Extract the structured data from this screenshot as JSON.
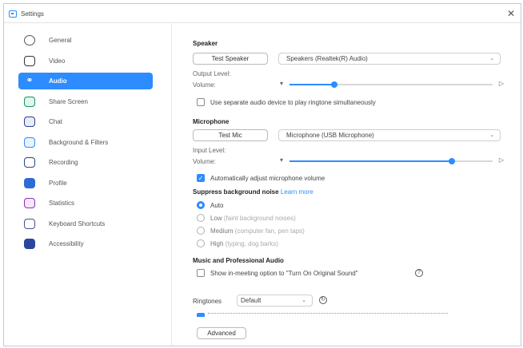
{
  "window": {
    "title": "Settings",
    "close_glyph": "✕"
  },
  "sidebar": {
    "items": [
      {
        "label": "General",
        "icon": "gear-icon"
      },
      {
        "label": "Video",
        "icon": "video-icon"
      },
      {
        "label": "Audio",
        "icon": "headphones-icon",
        "active": true
      },
      {
        "label": "Share Screen",
        "icon": "share-screen-icon"
      },
      {
        "label": "Chat",
        "icon": "chat-icon"
      },
      {
        "label": "Background & Filters",
        "icon": "background-icon"
      },
      {
        "label": "Recording",
        "icon": "recording-icon"
      },
      {
        "label": "Profile",
        "icon": "profile-icon"
      },
      {
        "label": "Statistics",
        "icon": "statistics-icon"
      },
      {
        "label": "Keyboard Shortcuts",
        "icon": "keyboard-icon"
      },
      {
        "label": "Accessibility",
        "icon": "accessibility-icon"
      }
    ]
  },
  "speaker": {
    "title": "Speaker",
    "test_button": "Test Speaker",
    "device": "Speakers (Realtek(R) Audio)",
    "output_level_label": "Output Level:",
    "volume_label": "Volume:",
    "volume_level": 0.22,
    "separate_device_label": "Use separate audio device to play ringtone simultaneously",
    "separate_device_checked": false
  },
  "microphone": {
    "title": "Microphone",
    "test_button": "Test Mic",
    "device": "Microphone (USB Microphone)",
    "input_level_label": "Input Level:",
    "volume_label": "Volume:",
    "volume_level": 0.8,
    "auto_adjust_label": "Automatically adjust microphone volume",
    "auto_adjust_checked": true
  },
  "suppress": {
    "title": "Suppress background noise",
    "learn_more": "Learn more",
    "options": [
      {
        "name": "Auto",
        "desc": "",
        "selected": true
      },
      {
        "name": "Low",
        "desc": "(faint background noises)",
        "selected": false
      },
      {
        "name": "Medium",
        "desc": "(computer fan, pen taps)",
        "selected": false
      },
      {
        "name": "High",
        "desc": "(typing, dog barks)",
        "selected": false
      }
    ]
  },
  "music": {
    "title": "Music and Professional Audio",
    "show_option_label": "Show in-meeting option to \"Turn On Original Sound\"",
    "show_option_checked": false
  },
  "ringtones": {
    "label": "Ringtones",
    "value": "Default"
  },
  "advanced_button": "Advanced",
  "colors": {
    "accent": "#2d8cff",
    "border": "#c9c9c9"
  }
}
